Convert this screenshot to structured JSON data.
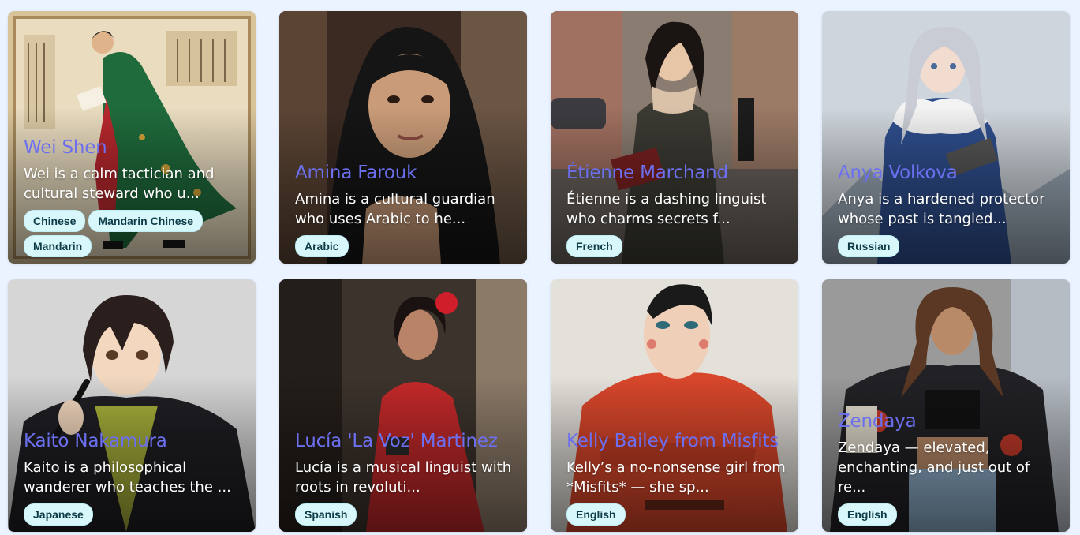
{
  "cards": [
    {
      "name": "Wei Shen",
      "description": "Wei is a calm tactician and cultural steward who u...",
      "tags": [
        "Chinese",
        "Mandarin Chinese",
        "Mandarin"
      ],
      "portrait": "scholar-in-green-robe-reading-book"
    },
    {
      "name": "Amina Farouk",
      "description": "Amina is a cultural guardian who uses Arabic to he...",
      "tags": [
        "Arabic"
      ],
      "portrait": "woman-in-black-hijab"
    },
    {
      "name": "Étienne Marchand",
      "description": "Étienne is a dashing linguist who charms secrets f...",
      "tags": [
        "French"
      ],
      "portrait": "woman-in-trench-coat-on-street"
    },
    {
      "name": "Anya Volkova",
      "description": "Anya is a hardened protector whose past is tangled...",
      "tags": [
        "Russian"
      ],
      "portrait": "anime-girl-in-blue-parka-snow"
    },
    {
      "name": "Kaito Nakamura",
      "description": "Kaito is a philosophical wanderer who teaches the ...",
      "tags": [
        "Japanese"
      ],
      "portrait": "anime-man-in-kimono-with-brush"
    },
    {
      "name": "Lucía 'La Voz' Martinez",
      "description": "Lucía is a musical linguist with roots in revoluti...",
      "tags": [
        "Spanish"
      ],
      "portrait": "woman-in-red-dress-with-flower"
    },
    {
      "name": "Kelly Bailey from Misfits",
      "description": "Kelly’s a no-nonsense girl from *Misfits* — she sp...",
      "tags": [
        "English"
      ],
      "portrait": "painted-woman-in-orange-jumpsuit"
    },
    {
      "name": "Zendaya",
      "description": "Zendaya — elevated, enchanting, and just out of re...",
      "tags": [
        "English"
      ],
      "portrait": "woman-in-racing-jacket"
    }
  ]
}
